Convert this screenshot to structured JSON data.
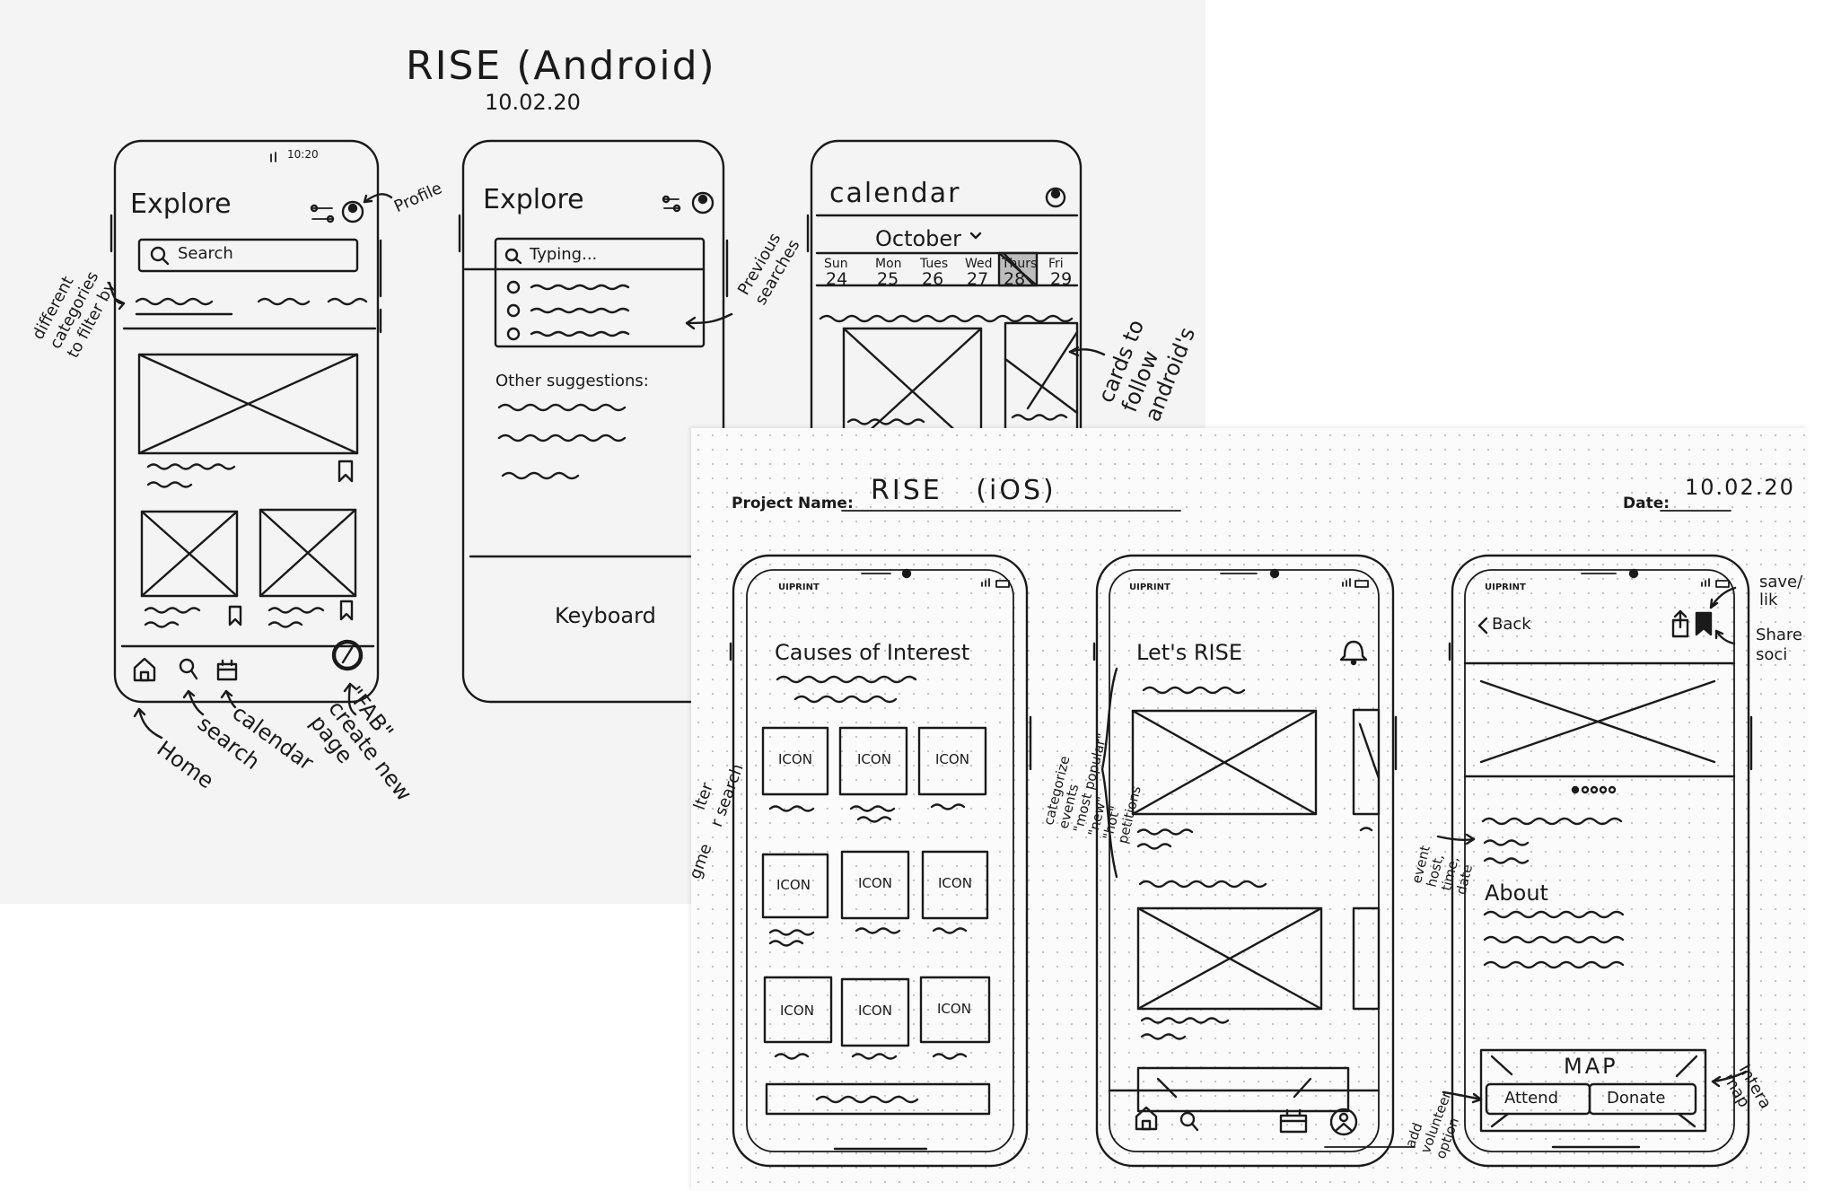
{
  "android": {
    "title": "RISE (Android)",
    "date": "10.02.20",
    "screen1": {
      "status_time": "10:20",
      "title": "Explore",
      "search_placeholder": "Search",
      "note_profile": "Profile",
      "note_categories": [
        "different",
        "categories",
        "to filter by"
      ],
      "note_fab": [
        "\"FAB\"",
        "create new",
        "page"
      ],
      "note_home": "Home",
      "note_search": "search",
      "note_calendar": "calendar"
    },
    "screen2": {
      "title": "Explore",
      "search_value": "Typing...",
      "note_previous": [
        "Previous",
        "searches"
      ],
      "suggestions_label": "Other suggestions:",
      "keyboard": "Keyboard"
    },
    "screen3": {
      "title": "calendar",
      "month": "October",
      "days": [
        {
          "name": "Sun",
          "num": "24"
        },
        {
          "name": "Mon",
          "num": "25"
        },
        {
          "name": "Tues",
          "num": "26"
        },
        {
          "name": "Wed",
          "num": "27"
        },
        {
          "name": "Thurs",
          "num": "28"
        },
        {
          "name": "Fri",
          "num": "29"
        }
      ],
      "note_cards": [
        "cards to",
        "follow",
        "android's"
      ]
    }
  },
  "ios": {
    "project_label": "Project Name:",
    "project_value": "RISE   (iOS)",
    "date_label": "Date:",
    "date_value": "10.02.20",
    "brand": "UIPRINT",
    "screen1": {
      "title": "Causes of Interest",
      "icon_label": "ICON",
      "note_left": [
        "lter",
        "r search",
        "gme"
      ]
    },
    "screen2": {
      "title": "Let's RISE",
      "note_categories": [
        "categorize",
        "events",
        "\"most popular\"",
        "\"new\"",
        "\"hot\"",
        "petitions"
      ]
    },
    "screen3": {
      "back": "Back",
      "about": "About",
      "map": "MAP",
      "attend": "Attend",
      "donate": "Donate",
      "note_save": [
        "save/",
        "lik"
      ],
      "note_share": [
        "Share",
        "soci"
      ],
      "note_event": [
        "event",
        "host,",
        "time,",
        "date"
      ],
      "note_volunteer": [
        "add",
        "volunteer",
        "option"
      ],
      "note_map": [
        "Intera",
        "map"
      ]
    }
  }
}
